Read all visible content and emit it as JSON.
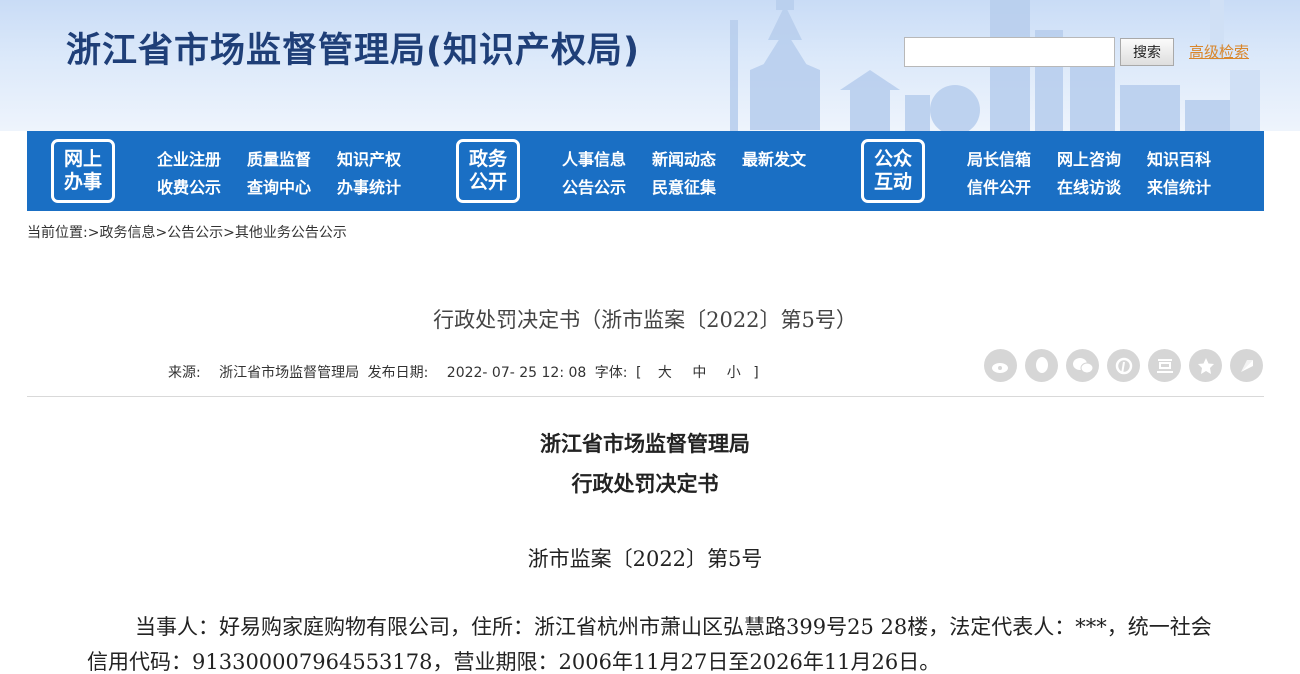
{
  "header": {
    "site_title": "浙江省市场监督管理局(知识产权局)",
    "search_placeholder": "",
    "search_button": "搜索",
    "advanced_search": "高级检索"
  },
  "nav": {
    "groups": [
      {
        "badge_line1": "网上",
        "badge_line2": "办事",
        "row1": [
          "企业注册",
          "质量监督",
          "知识产权"
        ],
        "row2": [
          "收费公示",
          "查询中心",
          "办事统计"
        ]
      },
      {
        "badge_line1": "政务",
        "badge_line2": "公开",
        "row1": [
          "人事信息",
          "新闻动态",
          "最新发文"
        ],
        "row2": [
          "公告公示",
          "民意征集"
        ]
      },
      {
        "badge_line1": "公众",
        "badge_line2": "互动",
        "row1": [
          "局长信箱",
          "网上咨询",
          "知识百科"
        ],
        "row2": [
          "信件公开",
          "在线访谈",
          "来信统计"
        ]
      }
    ]
  },
  "breadcrumb": "当前位置:>政务信息>公告公示>其他业务公告公示",
  "article": {
    "title": "行政处罚决定书（浙市监案〔2022〕第5号）",
    "source_label": "来源:",
    "source_value": "浙江省市场监督管理局",
    "date_label": "发布日期:",
    "date_value": "2022- 07- 25 12: 08",
    "font_label": "字体:",
    "font_open": "[",
    "font_large": "大",
    "font_medium": "中",
    "font_small": "小",
    "font_close": "]"
  },
  "share_icons": [
    "weibo-icon",
    "qq-icon",
    "wechat-icon",
    "pinterest-icon",
    "douban-icon",
    "favorite-icon",
    "more-share-icon"
  ],
  "document": {
    "org": "浙江省市场监督管理局",
    "type": "行政处罚决定书",
    "number": "浙市监案〔2022〕第5号",
    "paragraph": "当事人：好易购家庭购物有限公司，住所：浙江省杭州市萧山区弘慧路399号25 28楼，法定代表人：***，统一社会信用代码：913300007964553178，营业期限：2006年11月27日至2026年11月26日。"
  },
  "colors": {
    "nav_bg": "#1a6fc4",
    "title_blue": "#1f3f78",
    "link_orange": "#d9862b"
  }
}
